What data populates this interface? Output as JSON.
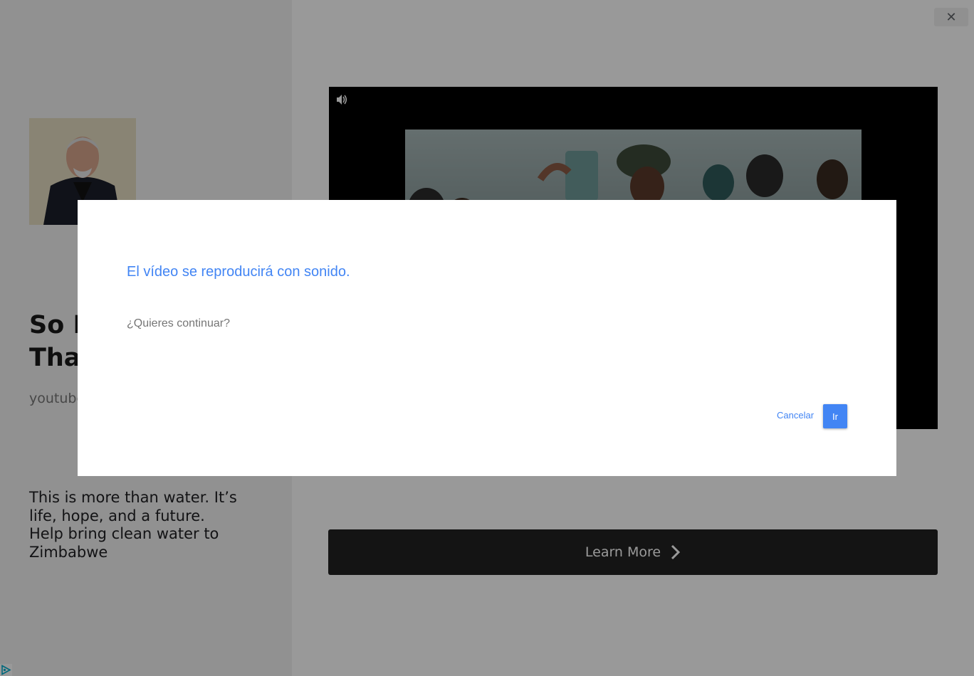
{
  "ad": {
    "close_icon": "close-icon",
    "title": "So Much More Than Water",
    "domain": "youtube.com",
    "body": "This is more than water. It’s life, hope, and a future. Help bring clean water to Zimbabwe",
    "learn_more_label": "Learn More",
    "video": {
      "volume_icon": "volume-icon"
    },
    "adchoices_icon": "adchoices-icon"
  },
  "dialog": {
    "title": "El vídeo se reproducirá con sonido.",
    "message": "¿Quieres continuar?",
    "cancel_label": "Cancelar",
    "go_label": "Ir"
  },
  "colors": {
    "dialog_accent": "#4285f4",
    "overlay": "rgba(0,0,0,0.4)",
    "cta_background": "#222222"
  }
}
